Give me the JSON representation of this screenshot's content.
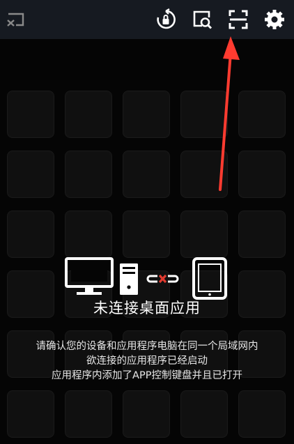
{
  "toolbar": {
    "icons": [
      "cast-icon",
      "screen-rotation-lock-icon",
      "screen-search-icon",
      "scan-icon",
      "settings-gear-icon"
    ]
  },
  "grid": {
    "rows": 6,
    "cols": 5
  },
  "annotation": {
    "color": "#ff3b30"
  },
  "connection": {
    "status": "未连接桌面应用",
    "hints": [
      "请确认您的设备和应用程序电脑在同一个局域网内",
      "欲连接的应用程序已经启动",
      "应用程序内添加了APP控制键盘并且已打开"
    ],
    "colors": {
      "broken_link": "#e03a2f",
      "icons": "#ffffff"
    }
  }
}
